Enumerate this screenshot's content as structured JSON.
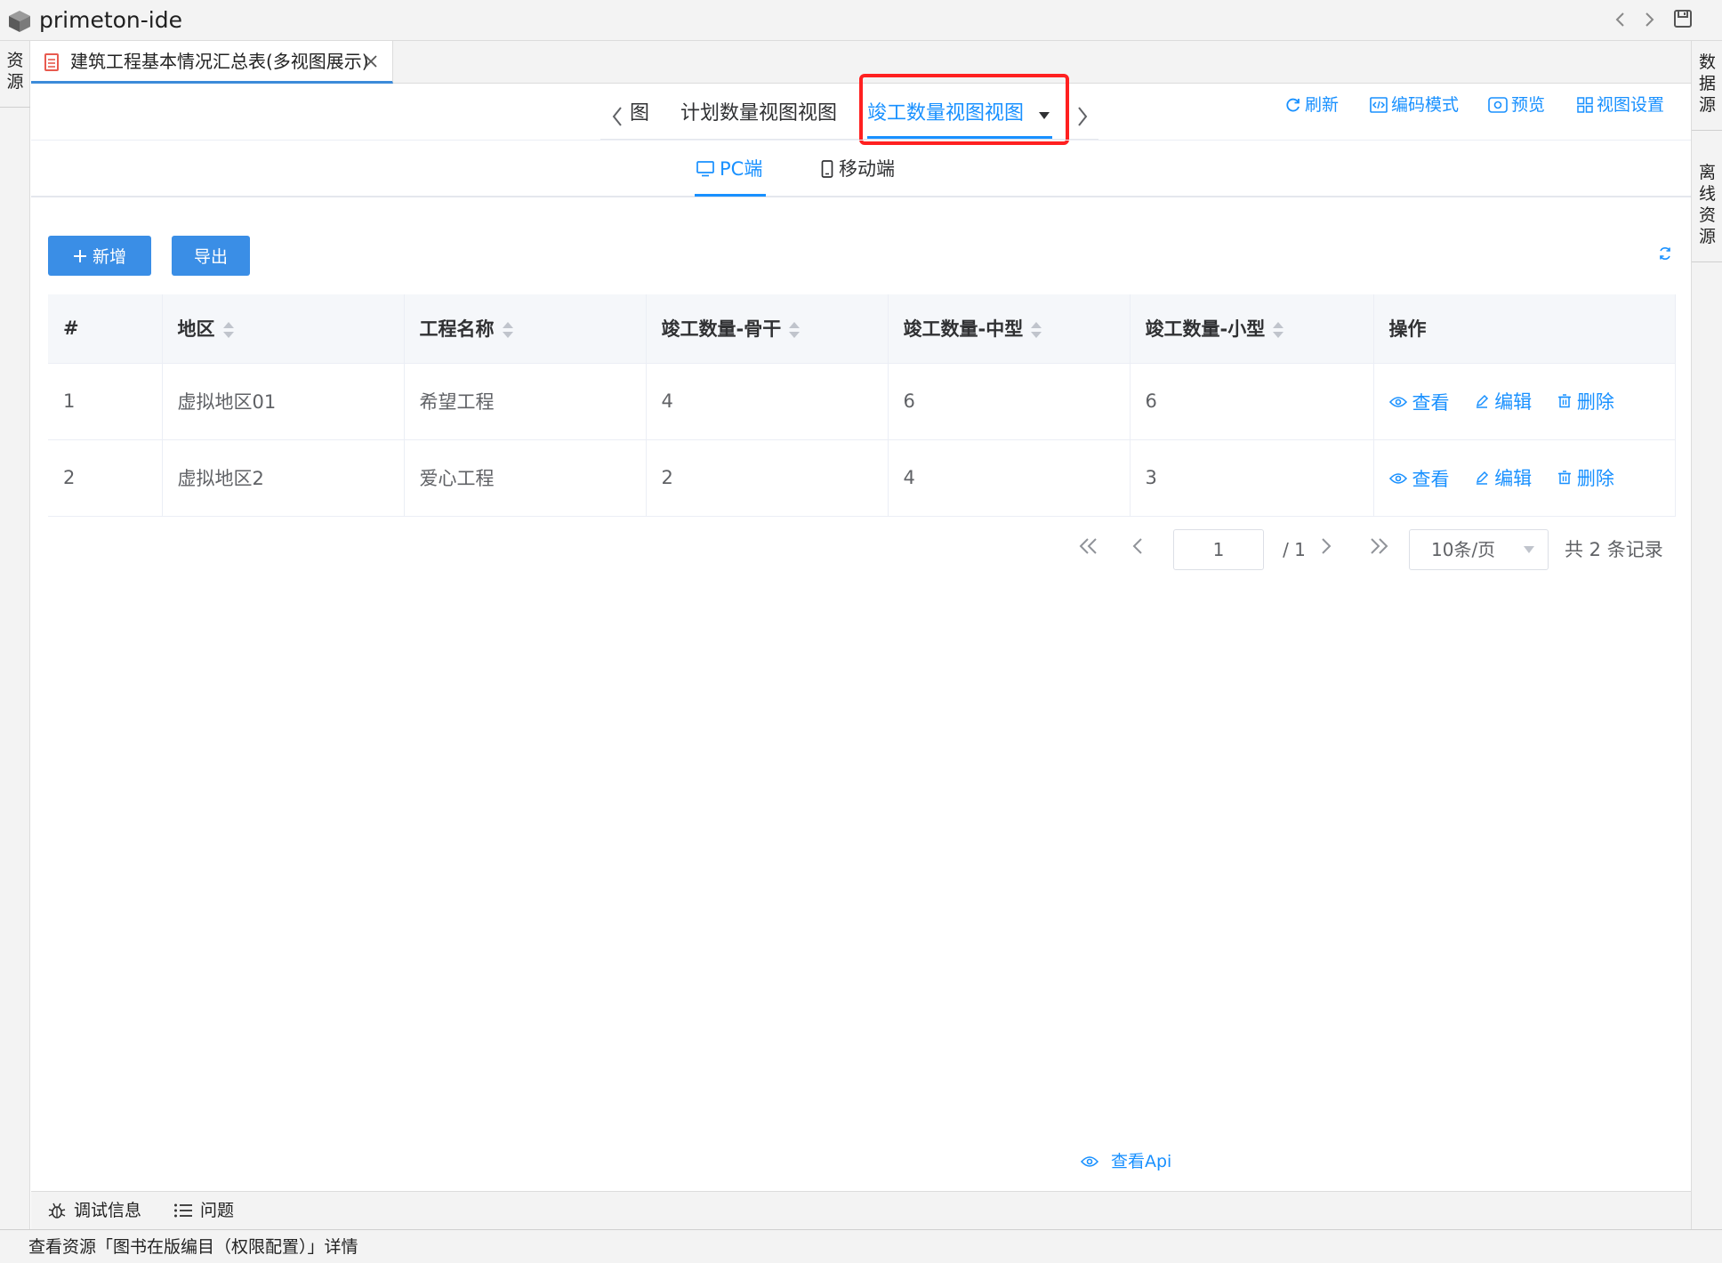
{
  "app": {
    "title": "primeton-ide"
  },
  "side_panels": {
    "left": [
      {
        "label": "资源"
      }
    ],
    "right": [
      {
        "label": "数据源"
      },
      {
        "label": "离线资源"
      }
    ]
  },
  "editor_tab": {
    "label": "建筑工程基本情况汇总表(多视图展示)"
  },
  "view_tabs": {
    "items": [
      {
        "label": "图"
      },
      {
        "label": "计划数量视图视图"
      },
      {
        "label": "竣工数量视图视图",
        "active": true
      }
    ]
  },
  "toolbar": {
    "refresh": "刷新",
    "code_mode": "编码模式",
    "preview": "预览",
    "view_settings": "视图设置"
  },
  "device_tabs": {
    "pc": "PC端",
    "mobile": "移动端",
    "active": "pc"
  },
  "actions": {
    "add": "新增",
    "export": "导出"
  },
  "table": {
    "columns": [
      "#",
      "地区",
      "工程名称",
      "竣工数量-骨干",
      "竣工数量-中型",
      "竣工数量-小型",
      "操作"
    ],
    "rows": [
      {
        "index": "1",
        "region": "虚拟地区01",
        "project": "希望工程",
        "backbone": "4",
        "medium": "6",
        "small": "6"
      },
      {
        "index": "2",
        "region": "虚拟地区2",
        "project": "爱心工程",
        "backbone": "2",
        "medium": "4",
        "small": "3"
      }
    ],
    "row_actions": {
      "view": "查看",
      "edit": "编辑",
      "delete": "删除"
    }
  },
  "pagination": {
    "current_page": "1",
    "total_pages": "/ 1",
    "page_size": "10条/页",
    "total_records": "共 2 条记录"
  },
  "api_link": "查看Api",
  "bottom_tabs": {
    "debug": "调试信息",
    "issues": "问题"
  },
  "status_bar": {
    "text": "查看资源「图书在版编目（权限配置）」详情"
  },
  "colors": {
    "accent": "#1890ff",
    "button": "#3a8ee6",
    "highlight": "#ff2020"
  }
}
